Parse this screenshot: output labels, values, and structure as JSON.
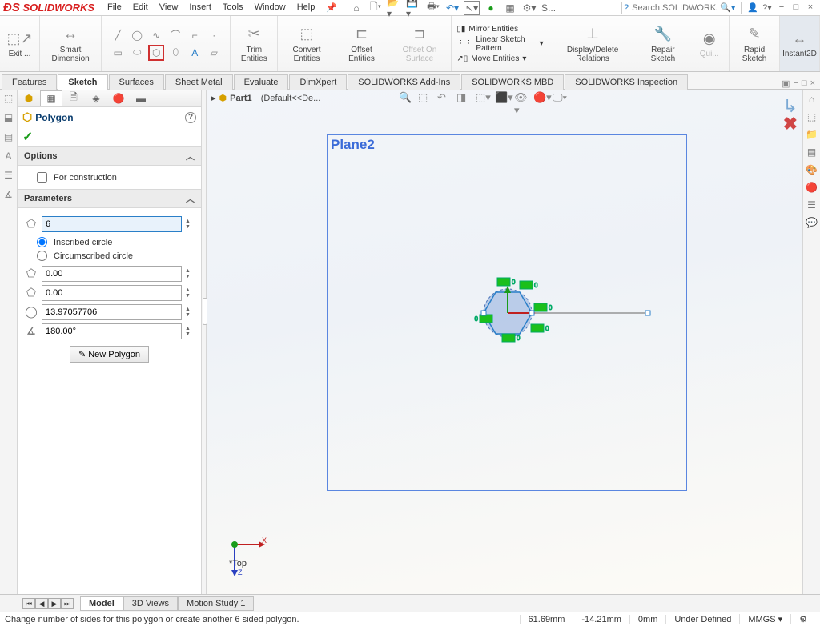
{
  "app": {
    "logo": "SOLIDWORKS"
  },
  "menu": [
    "File",
    "Edit",
    "View",
    "Insert",
    "Tools",
    "Window",
    "Help"
  ],
  "search": {
    "placeholder": "Search SOLIDWORKS"
  },
  "ribbon": {
    "exit": "Exit ...",
    "smart_dim": "Smart Dimension",
    "trim": "Trim Entities",
    "convert": "Convert Entities",
    "offset": "Offset Entities",
    "offset_surface": "Offset On Surface",
    "mirror": "Mirror Entities",
    "pattern": "Linear Sketch Pattern",
    "move": "Move Entities",
    "relations": "Display/Delete Relations",
    "repair": "Repair Sketch",
    "quick": "Qui...",
    "rapid": "Rapid Sketch",
    "instant": "Instant2D"
  },
  "tabs": [
    "Features",
    "Sketch",
    "Surfaces",
    "Sheet Metal",
    "Evaluate",
    "DimXpert",
    "SOLIDWORKS Add-Ins",
    "SOLIDWORKS MBD",
    "SOLIDWORKS Inspection"
  ],
  "tabs_active": 1,
  "breadcrumb": {
    "part": "Part1",
    "rest": "(Default<<De..."
  },
  "feature": {
    "title": "Polygon",
    "sections": {
      "options": "Options",
      "parameters": "Parameters"
    },
    "for_construction": "For construction",
    "inscribed": "Inscribed circle",
    "circumscribed": "Circumscribed circle",
    "sides": "6",
    "cx": "0.00",
    "cy": "0.00",
    "diameter": "13.97057706",
    "angle": "180.00°",
    "new_poly": "New Polygon"
  },
  "plane": "Plane2",
  "triad": "*Top",
  "bottom_tabs": [
    "Model",
    "3D Views",
    "Motion Study 1"
  ],
  "status": {
    "msg": "Change number of sides for this polygon or create another 6 sided polygon.",
    "x": "61.69mm",
    "y": "-14.21mm",
    "z": "0mm",
    "def": "Under Defined",
    "units": "MMGS"
  }
}
